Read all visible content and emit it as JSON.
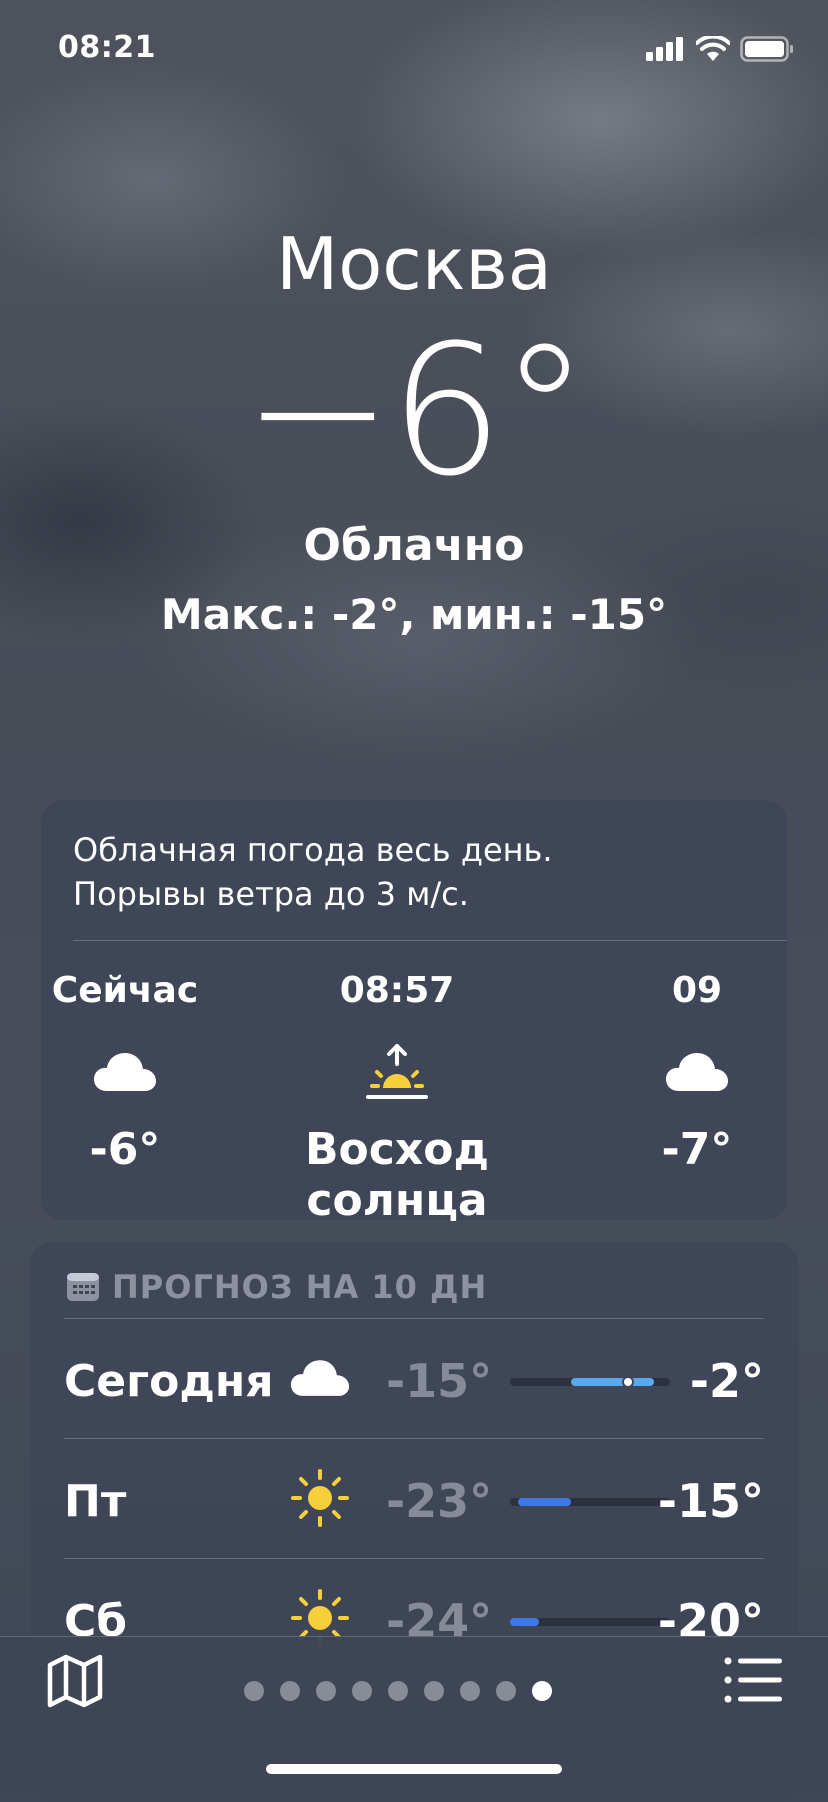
{
  "status_bar": {
    "time": "08:21"
  },
  "location": {
    "city": "Москва",
    "temperature": "−6°",
    "condition": "Облачно",
    "high_low": "Макс.: -2°, мин.: -15°"
  },
  "hourly": {
    "summary_line1": "Облачная погода весь день.",
    "summary_line2": "Порывы ветра до 3 м/с.",
    "items": [
      {
        "label": "Сейчас",
        "icon": "cloud-icon",
        "value": "-6°"
      },
      {
        "label": "08:57",
        "icon": "sunrise-icon",
        "value": "Восход солнца"
      },
      {
        "label": "09",
        "icon": "cloud-icon",
        "value": "-7°"
      }
    ]
  },
  "forecast": {
    "title": "ПРОГНОЗ НА 10 ДН",
    "icon": "calendar-icon",
    "days": [
      {
        "day": "Сегодня",
        "icon": "cloud-icon",
        "low": "-15°",
        "high": "-2°",
        "bar_start": 0.38,
        "bar_end": 0.9,
        "current_marker": 0.74,
        "bar_color": "#5aa8ee"
      },
      {
        "day": "Пт",
        "icon": "sun-icon",
        "low": "-23°",
        "high": "-15°",
        "bar_start": 0.05,
        "bar_end": 0.38,
        "bar_color": "#3c78e6"
      },
      {
        "day": "Сб",
        "icon": "sun-icon",
        "low": "-24°",
        "high": "-20°",
        "bar_start": 0.0,
        "bar_end": 0.18,
        "bar_color": "#3c78e6"
      }
    ]
  },
  "bottom_bar": {
    "map_icon": "map-icon",
    "list_icon": "list-icon",
    "page_count": 9,
    "active_page": 9
  },
  "colors": {
    "sun": "#f7cf3b",
    "bar_today": "#5aa8ee",
    "bar_cold": "#3c78e6"
  }
}
